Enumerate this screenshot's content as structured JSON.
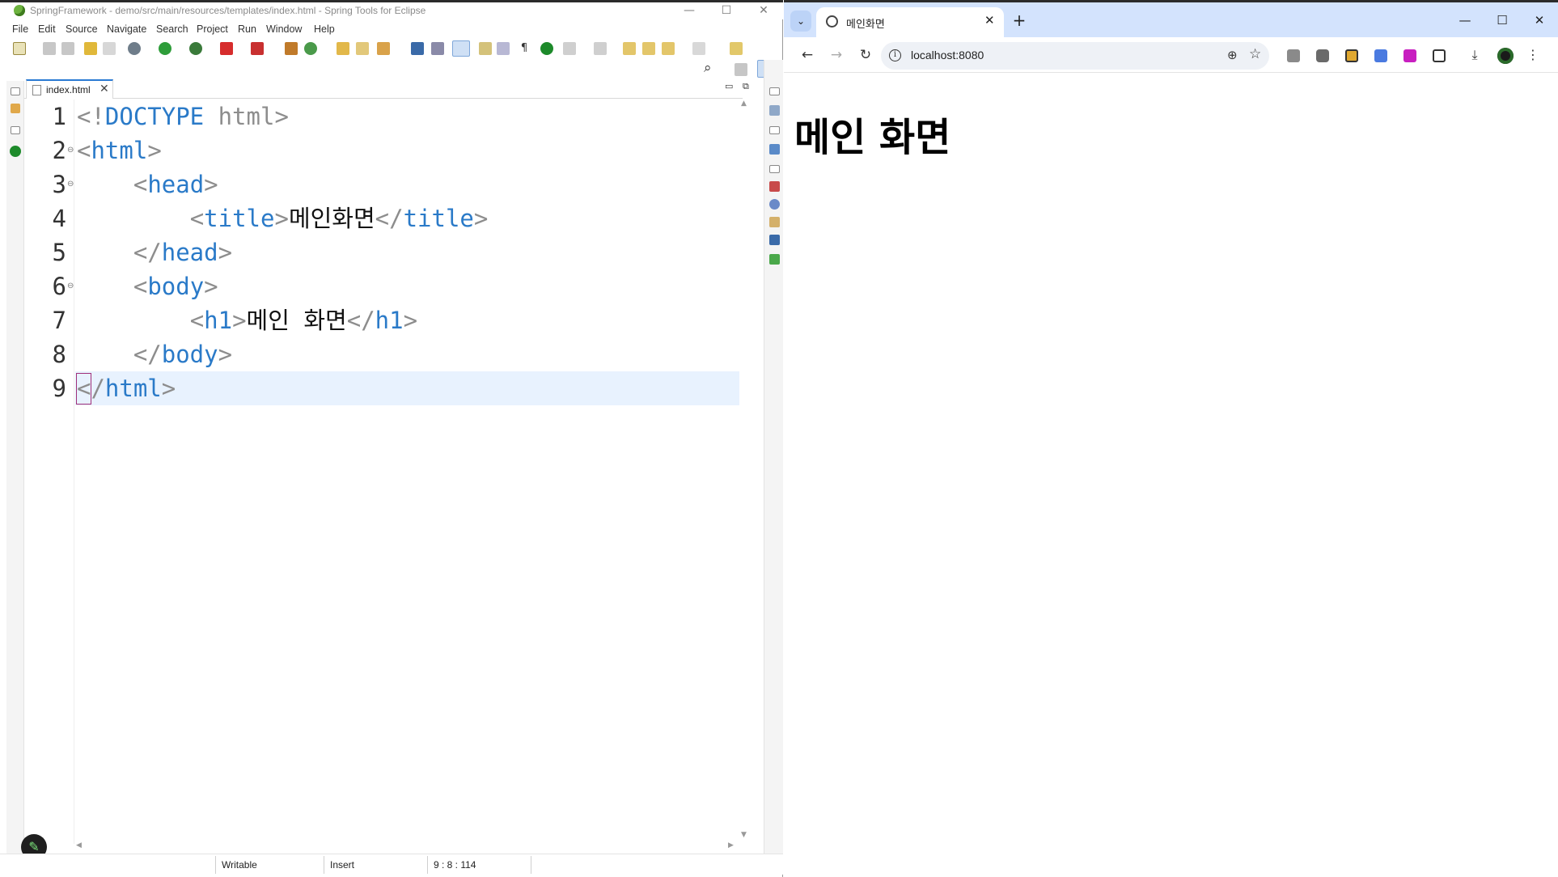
{
  "eclipse": {
    "window_title": "SpringFramework - demo/src/main/resources/templates/index.html - Spring Tools for Eclipse",
    "window_controls": {
      "minimize": "—",
      "maximize": "☐",
      "close": "✕"
    },
    "menu": [
      "File",
      "Edit",
      "Source",
      "Navigate",
      "Search",
      "Project",
      "Run",
      "Window",
      "Help"
    ],
    "editor_tab": {
      "label": "index.html",
      "close": "✕"
    },
    "line_numbers": [
      "1",
      "2",
      "3",
      "4",
      "5",
      "6",
      "7",
      "8",
      "9"
    ],
    "code_lines": [
      {
        "indent": "",
        "parts": [
          [
            "p",
            "<!"
          ],
          [
            "t",
            "DOCTYPE"
          ],
          [
            "p",
            " html>"
          ]
        ]
      },
      {
        "indent": "",
        "parts": [
          [
            "p",
            "<"
          ],
          [
            "t",
            "html"
          ],
          [
            "p",
            ">"
          ]
        ]
      },
      {
        "indent": "    ",
        "parts": [
          [
            "p",
            "<"
          ],
          [
            "t",
            "head"
          ],
          [
            "p",
            ">"
          ]
        ]
      },
      {
        "indent": "        ",
        "parts": [
          [
            "p",
            "<"
          ],
          [
            "t",
            "title"
          ],
          [
            "p",
            ">"
          ],
          [
            "x",
            "메인화면"
          ],
          [
            "p",
            "</"
          ],
          [
            "t",
            "title"
          ],
          [
            "p",
            ">"
          ]
        ]
      },
      {
        "indent": "    ",
        "parts": [
          [
            "p",
            "</"
          ],
          [
            "t",
            "head"
          ],
          [
            "p",
            ">"
          ]
        ]
      },
      {
        "indent": "    ",
        "parts": [
          [
            "p",
            "<"
          ],
          [
            "t",
            "body"
          ],
          [
            "p",
            ">"
          ]
        ]
      },
      {
        "indent": "        ",
        "parts": [
          [
            "p",
            "<"
          ],
          [
            "t",
            "h1"
          ],
          [
            "p",
            ">"
          ],
          [
            "x",
            "메인 화면"
          ],
          [
            "p",
            "</"
          ],
          [
            "t",
            "h1"
          ],
          [
            "p",
            ">"
          ]
        ]
      },
      {
        "indent": "    ",
        "parts": [
          [
            "p",
            "</"
          ],
          [
            "t",
            "body"
          ],
          [
            "p",
            ">"
          ]
        ]
      },
      {
        "indent": "",
        "parts": [
          [
            "p",
            "</"
          ],
          [
            "t",
            "html"
          ],
          [
            "p",
            ">"
          ]
        ]
      }
    ],
    "status": {
      "mode": "Writable",
      "insert": "Insert",
      "position": "9 : 8 : 114"
    },
    "colors": {
      "tag": "#2a7ac8",
      "punct": "#8d8d8d",
      "current_line": "#e8f2fe",
      "accent": "#6db33f"
    }
  },
  "chrome": {
    "tab_title": "메인화면",
    "tab_close": "✕",
    "new_tab": "+",
    "window_controls": {
      "minimize": "—",
      "maximize": "☐",
      "close": "✕"
    },
    "nav": {
      "back": "←",
      "forward": "→",
      "reload": "↻"
    },
    "url": "localhost:8080",
    "page_heading": "메인 화면",
    "icons": [
      "zoom-icon",
      "bookmark-star-icon",
      "cast-icon",
      "camera-icon",
      "extension-icon",
      "translate-icon",
      "download-ext-icon",
      "puzzle-icon",
      "download-icon",
      "profile-avatar",
      "kebab-menu-icon"
    ],
    "colors": {
      "tabbar": "#d3e3fd",
      "omnibox": "#eef1f6"
    }
  }
}
